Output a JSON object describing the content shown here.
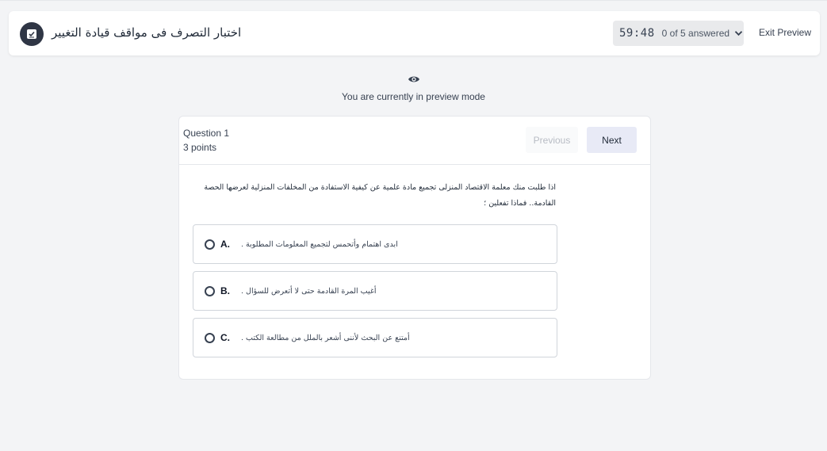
{
  "header": {
    "quiz_title": "اختبار التصرف فى مواقف قيادة التغيير",
    "timer": "59:48",
    "answered_status": "0 of 5 answered",
    "exit_label": "Exit Preview"
  },
  "preview": {
    "message": "You are currently in preview mode"
  },
  "question": {
    "number_label": "Question 1",
    "points_label": "3 points",
    "previous_label": "Previous",
    "next_label": "Next",
    "text": "اذا طلبت منك معلمة الاقتصاد المنزلى تجميع مادة علمية عن كيفية الاستفادة من المخلفات المنزلية لعرضها الحصة القادمة.. فماذا تفعلين ؛",
    "options": [
      {
        "letter": "A.",
        "text": "ابدى اهتمام وأتحمس لتجميع المعلومات المطلوبة ."
      },
      {
        "letter": "B.",
        "text": "أغيب المرة القادمة حتى لا أتعرض للسؤال ."
      },
      {
        "letter": "C.",
        "text": "أمتنع عن البحث لأننى أشعر بالملل من مطالعة الكتب ."
      }
    ]
  },
  "colors": {
    "badge": "#2f3645",
    "next_button_bg": "#e8eaf6",
    "page_bg": "#f3f4f6"
  },
  "icons": {
    "badge": "quiz-check-icon",
    "status": "chevron-down-icon",
    "preview": "eye-icon",
    "option": "radio-unchecked-icon"
  }
}
